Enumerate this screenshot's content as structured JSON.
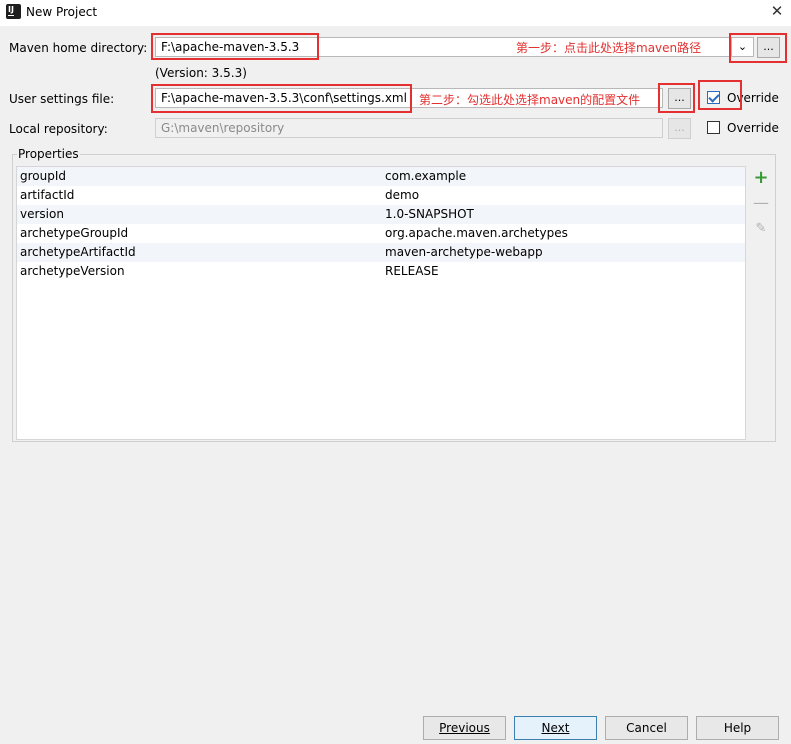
{
  "window": {
    "title": "New Project"
  },
  "maven_home": {
    "label": "Maven home directory:",
    "value": "F:\\apache-maven-3.5.3",
    "annotation": "第一步：点击此处选择maven路径",
    "browse_label": "...",
    "version_text": "(Version: 3.5.3)"
  },
  "user_settings": {
    "label": "User settings file:",
    "value": "F:\\apache-maven-3.5.3\\conf\\settings.xml",
    "annotation": "第二步：勾选此处选择maven的配置文件",
    "browse_label": "...",
    "override_label": "Override",
    "override_checked": true
  },
  "local_repo": {
    "label": "Local repository:",
    "value": "G:\\maven\\repository",
    "browse_label": "...",
    "override_label": "Override",
    "override_checked": false
  },
  "properties": {
    "title": "Properties",
    "rows": [
      {
        "key": "groupId",
        "value": "com.example"
      },
      {
        "key": "artifactId",
        "value": "demo"
      },
      {
        "key": "version",
        "value": "1.0-SNAPSHOT"
      },
      {
        "key": "archetypeGroupId",
        "value": "org.apache.maven.archetypes"
      },
      {
        "key": "archetypeArtifactId",
        "value": "maven-archetype-webapp"
      },
      {
        "key": "archetypeVersion",
        "value": "RELEASE"
      }
    ]
  },
  "buttons": {
    "previous": "Previous",
    "next": "Next",
    "cancel": "Cancel",
    "help": "Help"
  },
  "colors": {
    "annotation_red": "#e43030",
    "add_green": "#3a9a3a",
    "checkbox_blue": "#2b6ac2"
  }
}
